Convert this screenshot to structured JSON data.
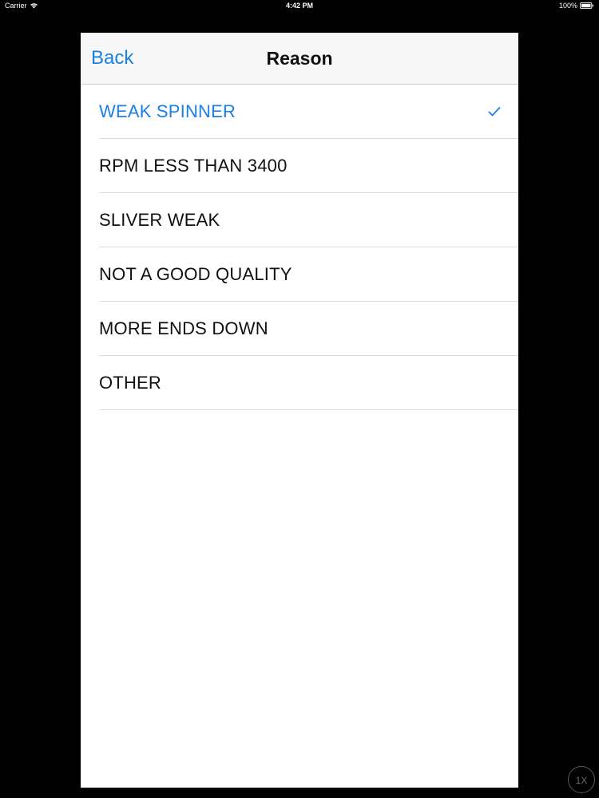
{
  "status_bar": {
    "carrier": "Carrier",
    "time": "4:42 PM",
    "battery": "100%"
  },
  "navbar": {
    "back_label": "Back",
    "title": "Reason"
  },
  "reasons": [
    {
      "label": "WEAK SPINNER",
      "selected": true
    },
    {
      "label": "RPM LESS THAN 3400",
      "selected": false
    },
    {
      "label": "SLIVER WEAK",
      "selected": false
    },
    {
      "label": "NOT A GOOD QUALITY",
      "selected": false
    },
    {
      "label": "MORE ENDS DOWN",
      "selected": false
    },
    {
      "label": "OTHER",
      "selected": false
    }
  ],
  "overlay": {
    "speed_label": "1X"
  },
  "colors": {
    "accent": "#1a80e6",
    "background": "#000000"
  }
}
